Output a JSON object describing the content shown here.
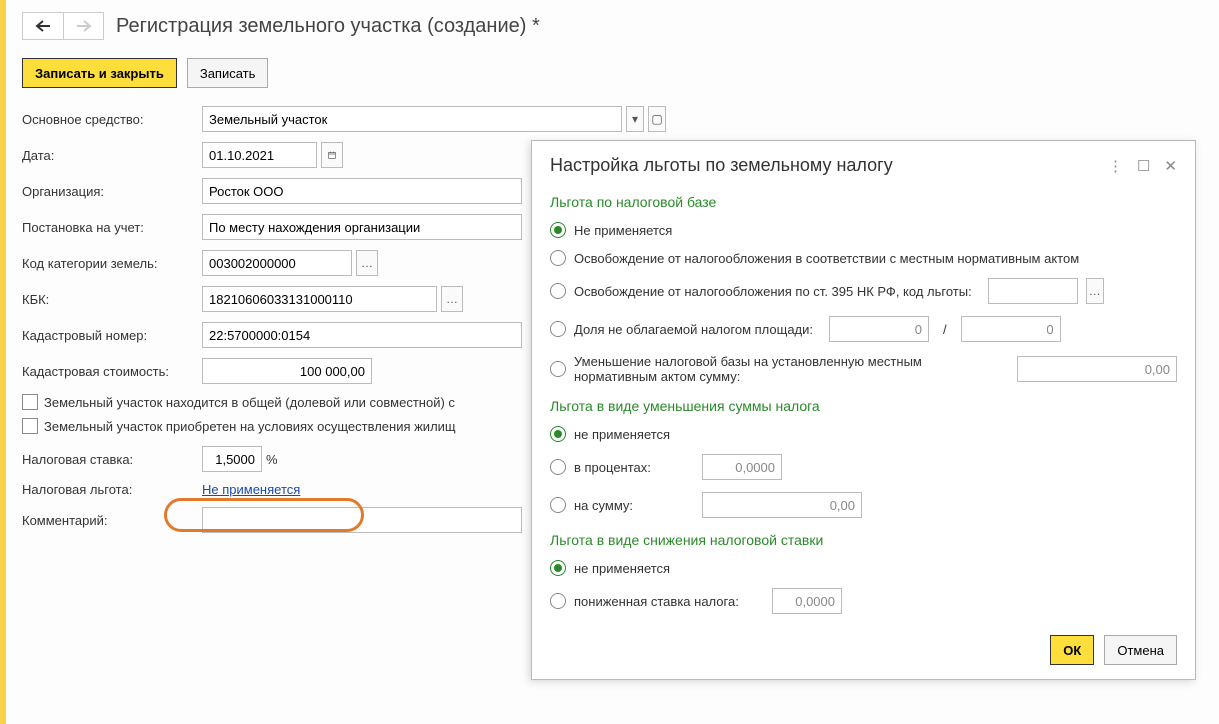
{
  "title": "Регистрация земельного участка (создание) *",
  "actions": {
    "save_close": "Записать и закрыть",
    "save": "Записать"
  },
  "form": {
    "fixed_asset_label": "Основное средство:",
    "fixed_asset_value": "Земельный участок",
    "date_label": "Дата:",
    "date_value": "01.10.2021",
    "org_label": "Организация:",
    "org_value": "Росток ООО",
    "reg_label": "Постановка на учет:",
    "reg_value": "По месту нахождения организации",
    "cat_code_label": "Код категории земель:",
    "cat_code_value": "003002000000",
    "kbk_label": "КБК:",
    "kbk_value": "18210606033131000110",
    "cad_num_label": "Кадастровый номер:",
    "cad_num_value": "22:5700000:0154",
    "cad_val_label": "Кадастровая стоимость:",
    "cad_val_value": "100 000,00",
    "chk_shared": "Земельный участок находится в общей (долевой или совместной) с",
    "chk_housing": "Земельный участок приобретен на условиях осуществления жилищ",
    "tax_rate_label": "Налоговая ставка:",
    "tax_rate_value": "1,5000",
    "tax_rate_pct": "%",
    "benefit_label": "Налоговая льгота:",
    "benefit_link": "Не применяется",
    "comment_label": "Комментарий:"
  },
  "panel": {
    "title": "Настройка льготы по земельному налогу",
    "sect1": "Льгота по налоговой базе",
    "r1": "Не применяется",
    "r2": "Освобождение от налогообложения в соответствии с местным нормативным актом",
    "r3": "Освобождение от налогообложения по ст. 395 НК РФ, код льготы:",
    "r4": "Доля не облагаемой налогом площади:",
    "r4_n": "0",
    "r4_d": "0",
    "slash": "/",
    "r5": "Уменьшение налоговой базы на установленную местным нормативным актом сумму:",
    "r5_v": "0,00",
    "sect2": "Льгота в виде уменьшения суммы налога",
    "r2a": "не применяется",
    "r2b": "в процентах:",
    "r2b_v": "0,0000",
    "r2c": "на сумму:",
    "r2c_v": "0,00",
    "sect3": "Льгота в виде снижения налоговой ставки",
    "r3a": "не применяется",
    "r3b": "пониженная ставка налога:",
    "r3b_v": "0,0000",
    "ok": "ОК",
    "cancel": "Отмена",
    "ellipsis": "…"
  }
}
